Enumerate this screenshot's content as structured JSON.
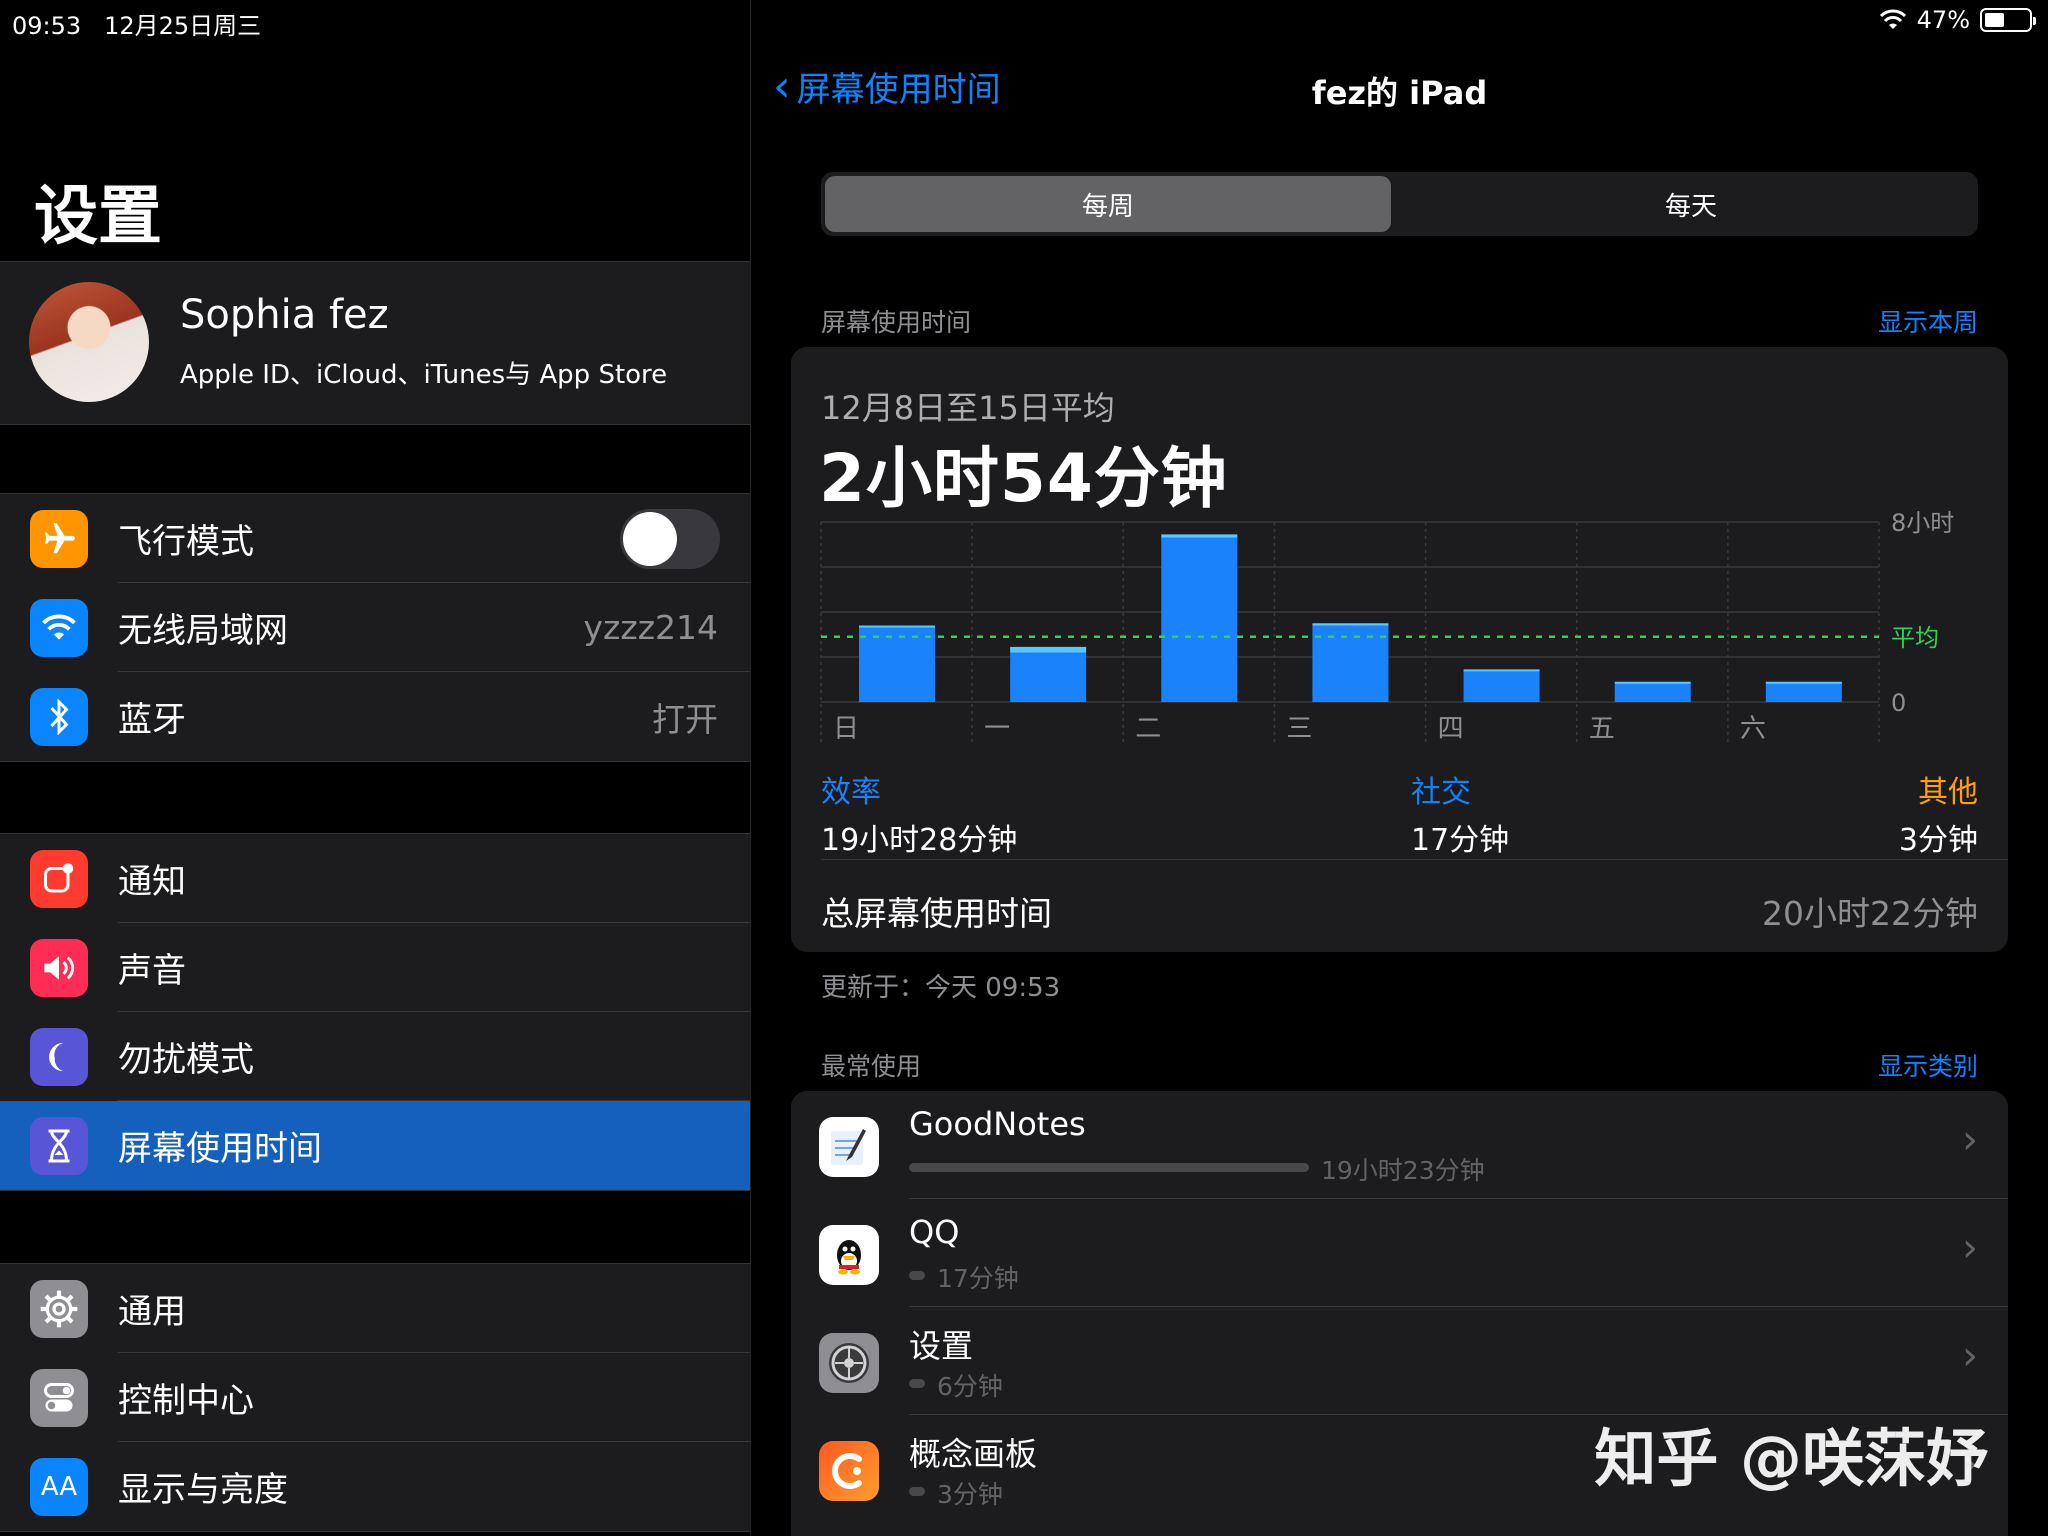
{
  "status": {
    "time": "09:53",
    "date": "12月25日周三",
    "battery": "47%"
  },
  "sidebar": {
    "title": "设置",
    "profile": {
      "name": "Sophia fez",
      "subtitle": "Apple ID、iCloud、iTunes与 App Store"
    },
    "group1": [
      {
        "label": "飞行模式",
        "icon": "airplane-icon",
        "color": "#ff9500",
        "toggle": false
      },
      {
        "label": "无线局域网",
        "icon": "wifi-icon",
        "color": "#0a84ff",
        "value": "yzzz214"
      },
      {
        "label": "蓝牙",
        "icon": "bluetooth-icon",
        "color": "#0a84ff",
        "value": "打开"
      }
    ],
    "group2": [
      {
        "label": "通知",
        "icon": "notifications-icon",
        "color": "#ff3b30"
      },
      {
        "label": "声音",
        "icon": "sound-icon",
        "color": "#ff2d55"
      },
      {
        "label": "勿扰模式",
        "icon": "moon-icon",
        "color": "#5856d6"
      },
      {
        "label": "屏幕使用时间",
        "icon": "hourglass-icon",
        "color": "#5856d6",
        "selected": true
      }
    ],
    "group3": [
      {
        "label": "通用",
        "icon": "gear-icon",
        "color": "#8e8e93"
      },
      {
        "label": "控制中心",
        "icon": "control-center-icon",
        "color": "#8e8e93"
      },
      {
        "label": "显示与亮度",
        "icon": "display-icon",
        "color": "#0a84ff",
        "text": "AA"
      }
    ]
  },
  "main": {
    "back_label": "屏幕使用时间",
    "title": "fez的 iPad",
    "segments": [
      "每周",
      "每天"
    ],
    "section1": {
      "header": "屏幕使用时间",
      "link": "显示本周"
    },
    "summary": {
      "avg_label": "12月8日至15日平均",
      "avg_value": "2小时54分钟",
      "total_label": "总屏幕使用时间",
      "total_value": "20小时22分钟"
    },
    "updated": "更新于：今天 09:53",
    "section2": {
      "header": "最常使用",
      "link": "显示类别"
    },
    "apps": [
      {
        "name": "GoodNotes",
        "time": "19小时23分钟",
        "fraction": 1.0,
        "icon": "goodnotes-icon"
      },
      {
        "name": "QQ",
        "time": "17分钟",
        "fraction": 0.015,
        "icon": "qq-icon"
      },
      {
        "name": "设置",
        "time": "6分钟",
        "fraction": 0.005,
        "icon": "settings-app-icon"
      },
      {
        "name": "概念画板",
        "time": "3分钟",
        "fraction": 0.003,
        "icon": "concepts-icon"
      }
    ]
  },
  "chart_data": {
    "type": "bar",
    "categories": [
      "日",
      "一",
      "二",
      "三",
      "四",
      "五",
      "六"
    ],
    "series": [
      {
        "name": "效率",
        "values": [
          3.3,
          2.2,
          7.3,
          3.4,
          1.4,
          0.85,
          0.85
        ]
      },
      {
        "name": "社交",
        "values": [
          0.1,
          0.25,
          0.15,
          0.1,
          0.05,
          0.05,
          0.05
        ]
      }
    ],
    "average": 2.9,
    "ylim": [
      0,
      8
    ],
    "yticks": [
      "8小时",
      "平均",
      "0"
    ],
    "colors": {
      "效率": "#1a82fb",
      "社交": "#5ac8fa",
      "其他": "#ff9f0a",
      "average": "#30d158"
    },
    "legend": [
      {
        "name": "效率",
        "value": "19小时28分钟"
      },
      {
        "name": "社交",
        "value": "17分钟"
      },
      {
        "name": "其他",
        "value": "3分钟"
      }
    ]
  },
  "watermark": "知乎 @咲莯妤"
}
